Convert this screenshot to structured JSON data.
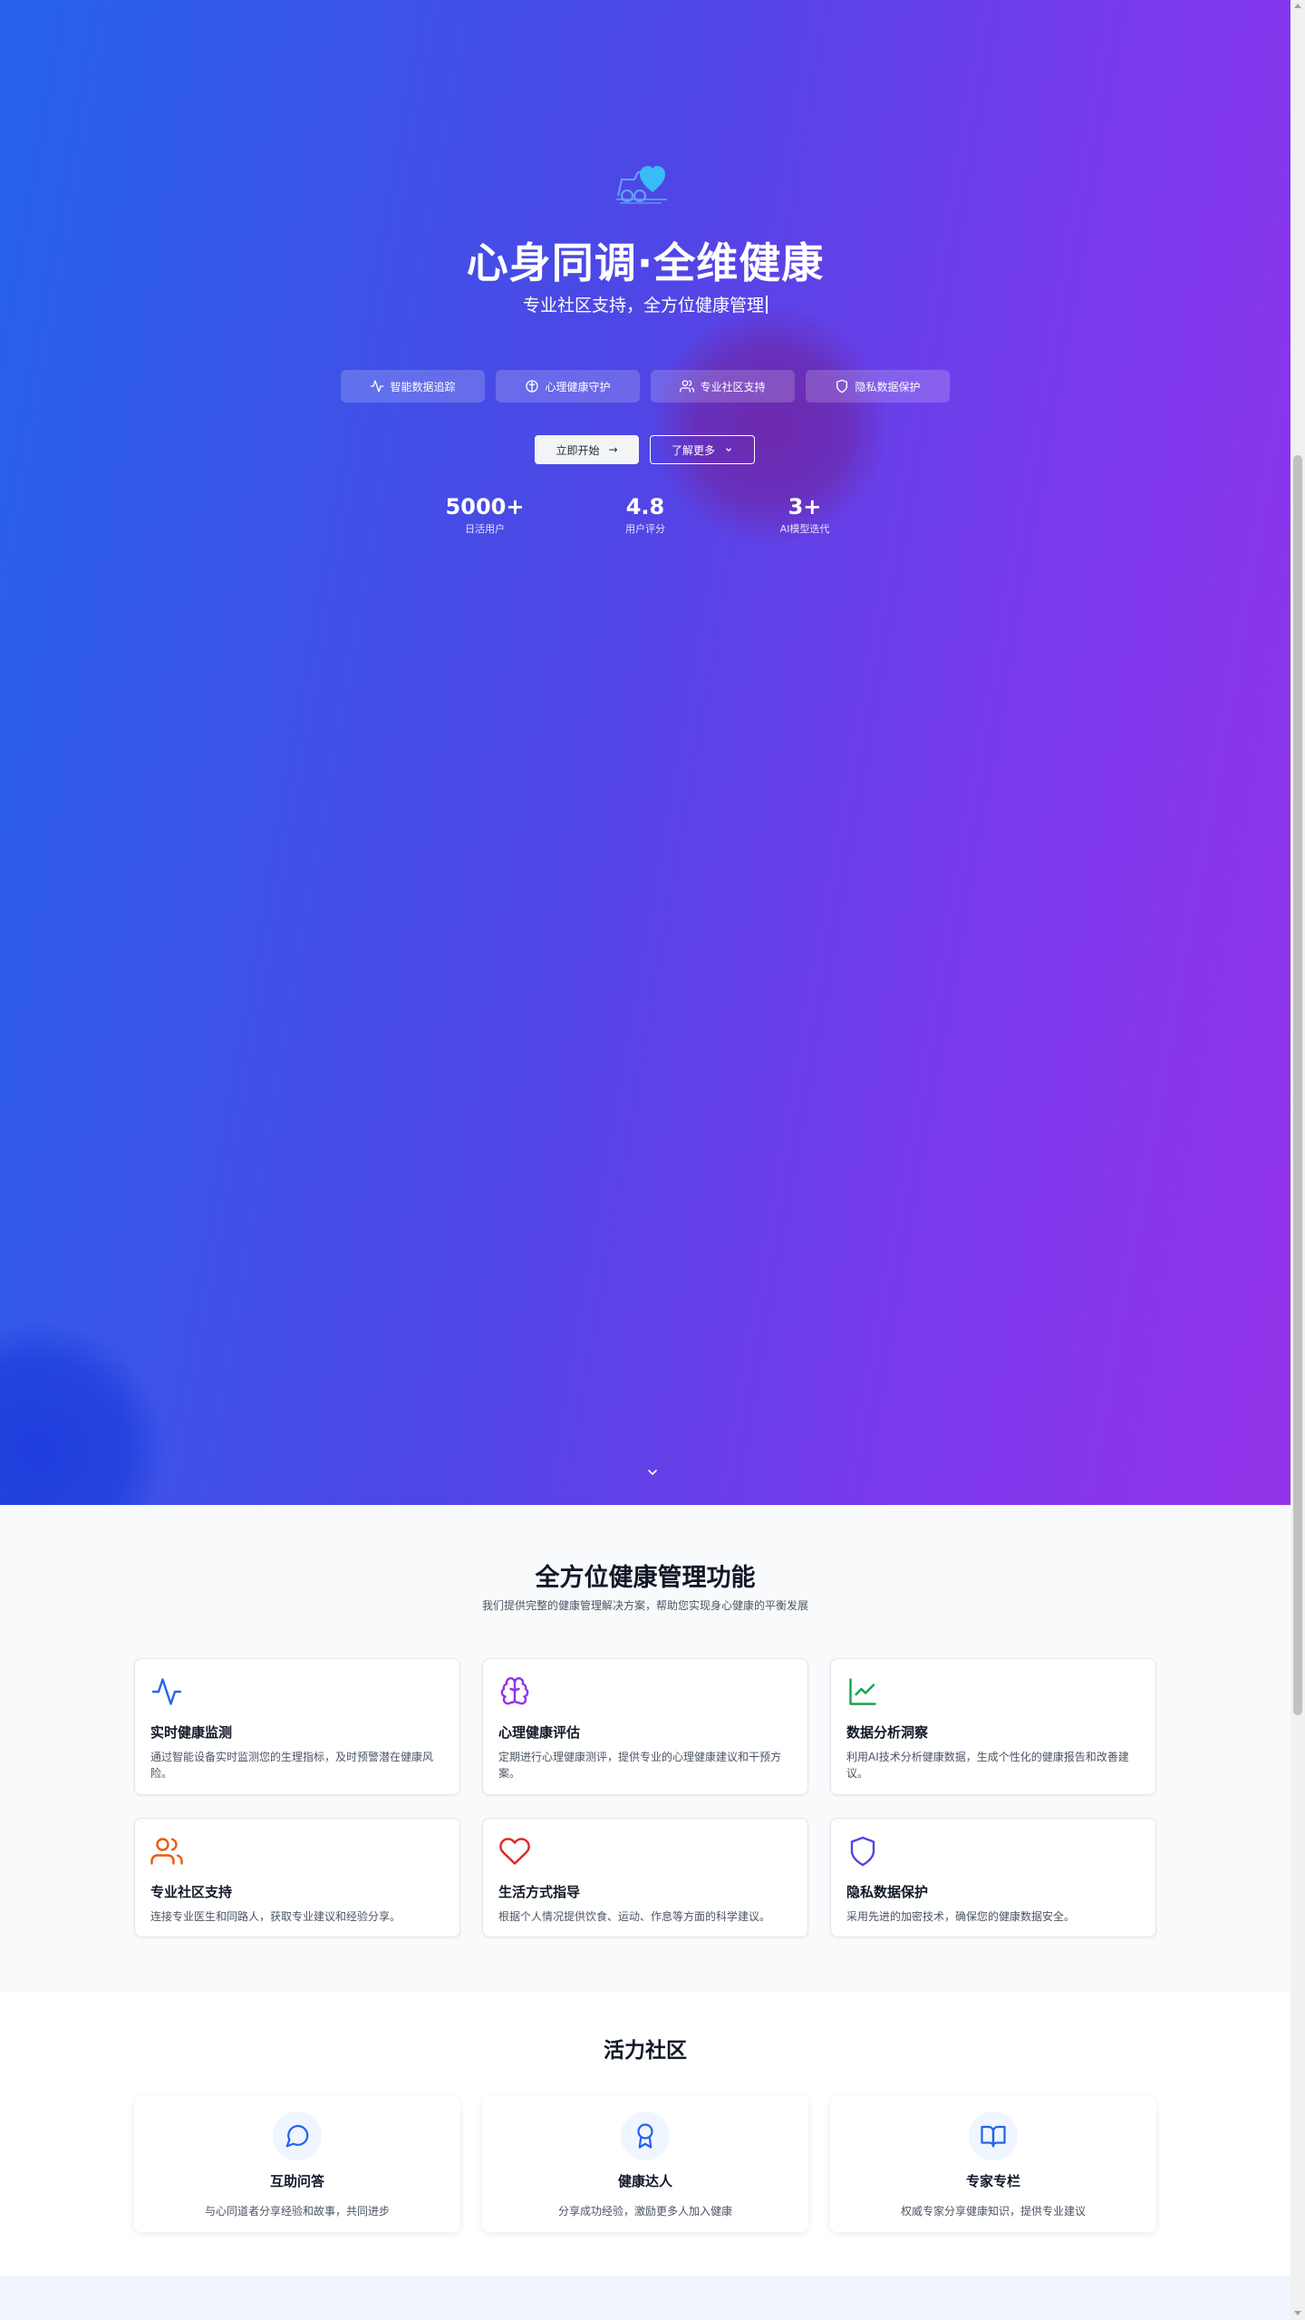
{
  "hero": {
    "title": "心身同调·全维健康",
    "subtitle": "专业社区支持，全方位健康管理",
    "pills": [
      {
        "label": "智能数据追踪",
        "icon": "activity-icon"
      },
      {
        "label": "心理健康守护",
        "icon": "brain-icon"
      },
      {
        "label": "专业社区支持",
        "icon": "users-icon"
      },
      {
        "label": "隐私数据保护",
        "icon": "shield-icon"
      }
    ],
    "primary_button": "立即开始",
    "secondary_button": "了解更多",
    "stats": [
      {
        "value": "5000+",
        "label": "日活用户"
      },
      {
        "value": "4.8",
        "label": "用户评分"
      },
      {
        "value": "3+",
        "label": "AI模型迭代"
      }
    ]
  },
  "features": {
    "title": "全方位健康管理功能",
    "subtitle": "我们提供完整的健康管理解决方案，帮助您实现身心健康的平衡发展",
    "cards": [
      {
        "title": "实时健康监测",
        "desc": "通过智能设备实时监测您的生理指标，及时预警潜在健康风险。",
        "icon": "activity-icon",
        "color": "#2563eb"
      },
      {
        "title": "心理健康评估",
        "desc": "定期进行心理健康测评，提供专业的心理健康建议和干预方案。",
        "icon": "brain-icon",
        "color": "#9333ea"
      },
      {
        "title": "数据分析洞察",
        "desc": "利用AI技术分析健康数据，生成个性化的健康报告和改善建议。",
        "icon": "line-chart-icon",
        "color": "#16a34a"
      },
      {
        "title": "专业社区支持",
        "desc": "连接专业医生和同路人，获取专业建议和经验分享。",
        "icon": "users-icon",
        "color": "#ea580c"
      },
      {
        "title": "生活方式指导",
        "desc": "根据个人情况提供饮食、运动、作息等方面的科学建议。",
        "icon": "heart-icon",
        "color": "#dc2626"
      },
      {
        "title": "隐私数据保护",
        "desc": "采用先进的加密技术，确保您的健康数据安全。",
        "icon": "shield-icon",
        "color": "#4f46e5"
      }
    ]
  },
  "community": {
    "title": "活力社区",
    "cards": [
      {
        "title": "互助问答",
        "desc": "与心同道者分享经验和故事，共同进步",
        "icon": "message-circle-icon"
      },
      {
        "title": "健康达人",
        "desc": "分享成功经验，激励更多人加入健康",
        "icon": "award-icon"
      },
      {
        "title": "专家专栏",
        "desc": "权威专家分享健康知识，提供专业建议",
        "icon": "book-open-icon"
      }
    ]
  },
  "colors": {
    "hero_gradient_start": "#2563eb",
    "hero_gradient_end": "#9333ea",
    "community_icon": "#2563eb"
  }
}
